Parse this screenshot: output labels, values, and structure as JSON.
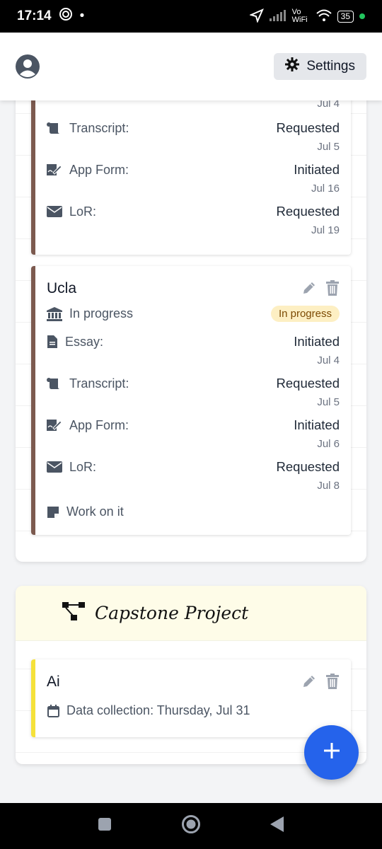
{
  "status_bar": {
    "time": "17:14",
    "network": "Vo WiFi",
    "battery": "35"
  },
  "header": {
    "settings_label": "Settings"
  },
  "group1": {
    "card_prev": {
      "top_date": "Jul 4",
      "rows": [
        {
          "icon": "scroll-icon",
          "label": "Transcript:",
          "status": "Requested",
          "date": "Jul 5"
        },
        {
          "icon": "signature-icon",
          "label": "App Form:",
          "status": "Initiated",
          "date": "Jul 16"
        },
        {
          "icon": "envelope-icon",
          "label": "LoR:",
          "status": "Requested",
          "date": "Jul 19"
        }
      ]
    },
    "card_ucla": {
      "title": "Ucla",
      "progress_label": "In progress",
      "badge": "In progress",
      "rows": [
        {
          "icon": "file-icon",
          "label": "Essay:",
          "status": "Initiated",
          "date": "Jul 4"
        },
        {
          "icon": "scroll-icon",
          "label": "Transcript:",
          "status": "Requested",
          "date": "Jul 5"
        },
        {
          "icon": "signature-icon",
          "label": "App Form:",
          "status": "Initiated",
          "date": "Jul 6"
        },
        {
          "icon": "envelope-icon",
          "label": "LoR:",
          "status": "Requested",
          "date": "Jul 8"
        }
      ],
      "note": "Work on it"
    }
  },
  "group2": {
    "title": "Capstone Project",
    "card_ai": {
      "title": "Ai",
      "detail": "Data collection: Thursday, Jul 31"
    }
  },
  "colors": {
    "accent_blue": "#2563eb",
    "brown": "#7c5a4f",
    "yellow": "#f5e13a",
    "badge_bg": "#fdefc3"
  }
}
